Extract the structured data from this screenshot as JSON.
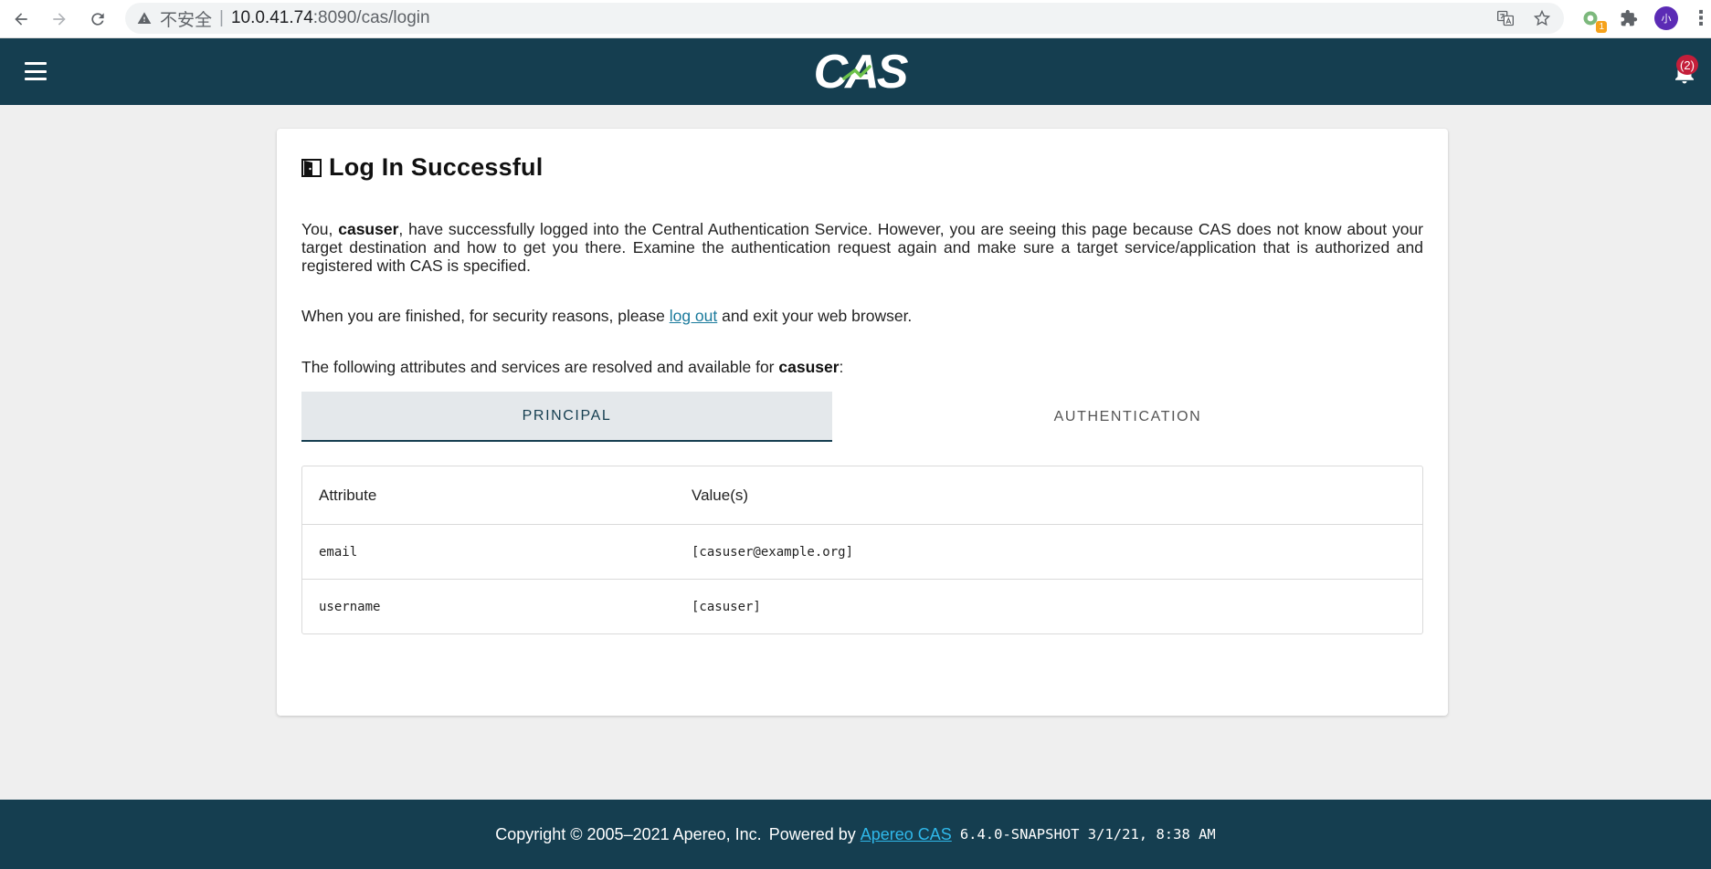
{
  "browser": {
    "insecure_label": "不安全",
    "separator": "|",
    "url_host": "10.0.41.74",
    "url_rest": ":8090/cas/login",
    "extension_badge": "1",
    "profile_initial": "小"
  },
  "header": {
    "logo_text": "CAS",
    "notification_count": "(2)"
  },
  "card": {
    "title": "Log In Successful",
    "p1_pre": "You, ",
    "p1_user": "casuser",
    "p1_post": ", have successfully logged into the Central Authentication Service. However, you are seeing this page because CAS does not know about your target destination and how to get you there. Examine the authentication request again and make sure a target service/application that is authorized and registered with CAS is specified.",
    "p2_pre": "When you are finished, for security reasons, please ",
    "p2_link": "log out",
    "p2_post": " and exit your web browser.",
    "p3_pre": "The following attributes and services are resolved and available for ",
    "p3_user": "casuser",
    "p3_post": ":"
  },
  "tabs": [
    {
      "label": "PRINCIPAL",
      "active": true
    },
    {
      "label": "AUTHENTICATION",
      "active": false
    }
  ],
  "table": {
    "headers": [
      "Attribute",
      "Value(s)"
    ],
    "rows": [
      [
        "email",
        "[casuser@example.org]"
      ],
      [
        "username",
        "[casuser]"
      ]
    ]
  },
  "footer": {
    "copyright": "Copyright © 2005–2021 Apereo, Inc.",
    "powered_by": "Powered by",
    "link": "Apereo CAS",
    "version": "6.4.0-SNAPSHOT 3/1/21, 8:38 AM"
  },
  "colors": {
    "header_bg": "#153e50",
    "link": "#1a7a9c",
    "footer_link": "#2fb8ea",
    "badge": "#c41e3a"
  }
}
